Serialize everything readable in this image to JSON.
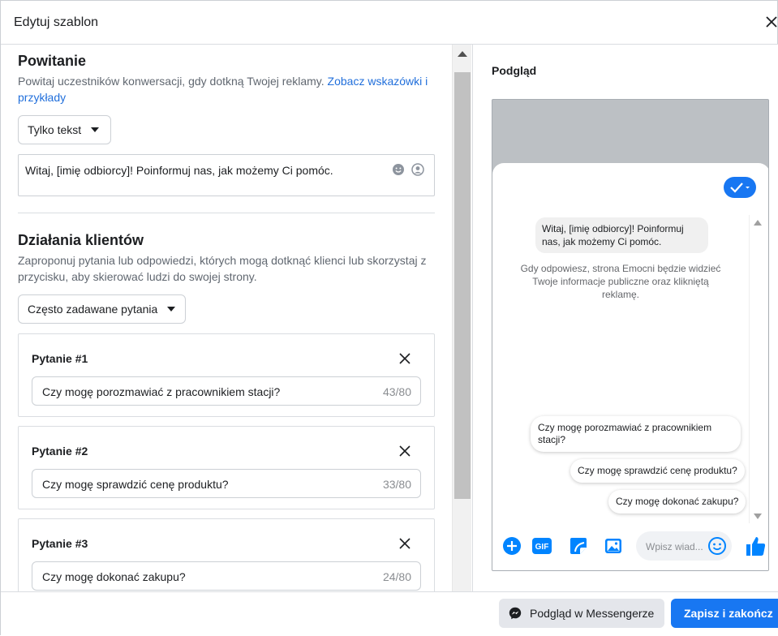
{
  "dialog": {
    "title": "Edytuj szablon"
  },
  "greeting": {
    "heading": "Powitanie",
    "description": "Powitaj uczestników konwersacji, gdy dotkną Twojej reklamy.",
    "link_text": "Zobacz wskazówki i przykłady",
    "format_dropdown": "Tylko tekst",
    "message": "Witaj, [imię odbiorcy]! Poinformuj nas, jak możemy Ci pomóc."
  },
  "customer_actions": {
    "heading": "Działania klientów",
    "description": "Zaproponuj pytania lub odpowiedzi, których mogą dotknąć klienci lub skorzystaj z przycisku, aby skierować ludzi do swojej strony.",
    "type_dropdown": "Często zadawane pytania",
    "questions": [
      {
        "label": "Pytanie #1",
        "value": "Czy mogę porozmawiać z pracownikiem stacji?",
        "count": "43/80"
      },
      {
        "label": "Pytanie #2",
        "value": "Czy mogę sprawdzić cenę produktu?",
        "count": "33/80"
      },
      {
        "label": "Pytanie #3",
        "value": "Czy mogę dokonać zakupu?",
        "count": "24/80"
      }
    ]
  },
  "preview": {
    "heading": "Podgląd",
    "greeting_bubble": "Witaj, [imię odbiorcy]! Poinformuj nas, jak możemy Ci pomóc.",
    "info_text": "Gdy odpowiesz, strona Emocni będzie widzieć Twoje informacje publiczne oraz klikniętą reklamę.",
    "quick_replies": [
      "Czy mogę porozmawiać z pracownikiem stacji?",
      "Czy mogę sprawdzić cenę produktu?",
      "Czy mogę dokonać zakupu?"
    ],
    "composer_placeholder": "Wpisz wiad...",
    "gif_label": "GIF"
  },
  "footer": {
    "preview_button": "Podgląd w Messengerze",
    "save_button": "Zapisz i zakończ"
  },
  "colors": {
    "accent": "#1877f2",
    "link": "#216fdb",
    "muted": "#606770"
  },
  "icons": [
    "close-icon",
    "emoji-icon",
    "personalize-icon",
    "messenger-icon",
    "plus-icon",
    "gif-icon",
    "sticker-icon",
    "image-icon",
    "like-icon",
    "check-icon"
  ]
}
